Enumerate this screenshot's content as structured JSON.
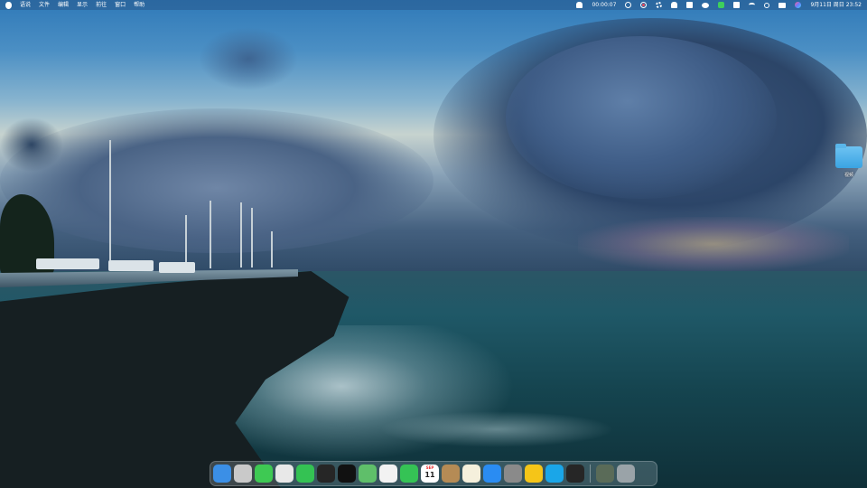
{
  "menubar": {
    "menus": [
      "语说",
      "文件",
      "编辑",
      "显示",
      "前往",
      "窗口",
      "帮助"
    ],
    "recording_timer": "00:00:07",
    "datetime": "9月11日 周日 23:52",
    "status_icons": [
      "notification-icon",
      "record-timer-icon",
      "stop-record-icon",
      "gear-icon",
      "bell-icon",
      "clipboard-icon",
      "wechat-icon",
      "green-app-icon",
      "flag-icon",
      "wifi-icon",
      "search-icon",
      "control-center-icon",
      "siri-icon"
    ]
  },
  "desktop": {
    "folder_label": "视频"
  },
  "dock": {
    "apps": [
      {
        "name": "finder",
        "color": "#3b8fe6"
      },
      {
        "name": "launchpad",
        "color": "#c9c9c9"
      },
      {
        "name": "messages",
        "color": "#3ec953"
      },
      {
        "name": "chrome",
        "color": "#e8e8e8"
      },
      {
        "name": "wechat",
        "color": "#34c253"
      },
      {
        "name": "qq",
        "color": "#262626"
      },
      {
        "name": "notion",
        "color": "#111111"
      },
      {
        "name": "maps",
        "color": "#5fbf6a"
      },
      {
        "name": "photos",
        "color": "#f2f2f2"
      },
      {
        "name": "facetime",
        "color": "#35c355"
      },
      {
        "name": "calendar",
        "color": "#ffffff",
        "month": "SEP",
        "day": "11"
      },
      {
        "name": "contacts",
        "color": "#b58b55"
      },
      {
        "name": "notes",
        "color": "#f5f0dc"
      },
      {
        "name": "app-store",
        "color": "#2a8cf2"
      },
      {
        "name": "system-preferences",
        "color": "#8a8a8a"
      },
      {
        "name": "tapd",
        "color": "#f5c518"
      },
      {
        "name": "video-app",
        "color": "#1aa6e8"
      },
      {
        "name": "qq-2",
        "color": "#262626"
      },
      {
        "name": "downloads",
        "color": "#5a6b58"
      },
      {
        "name": "trash",
        "color": "#9aa3a8"
      }
    ]
  }
}
